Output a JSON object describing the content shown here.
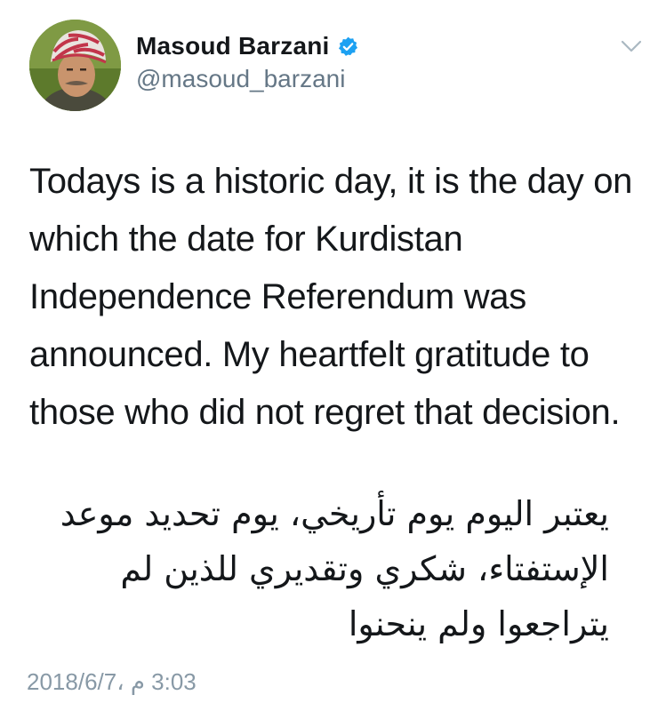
{
  "user": {
    "display_name": "Masoud Barzani",
    "handle": "@masoud_barzani",
    "verified": true
  },
  "icons": {
    "verified": "verified-badge-icon",
    "menu": "chevron-down-icon"
  },
  "tweet": {
    "text_en": "Todays is a historic day, it is the day on which the date for Kurdistan Independence Referendum was announced. My heartfelt gratitude to those who did not regret that decision.",
    "text_ar": "يعتبر اليوم يوم تأريخي، يوم تحديد موعد الإستفتاء، شكري وتقديري للذين لم يتراجعوا ولم ينحنوا",
    "timestamp": "3:03 م ،2018/6/7"
  },
  "colors": {
    "verified_blue": "#1da1f2",
    "secondary_text": "#657786",
    "timestamp_text": "#8899a6",
    "chevron": "#aab8c2"
  }
}
